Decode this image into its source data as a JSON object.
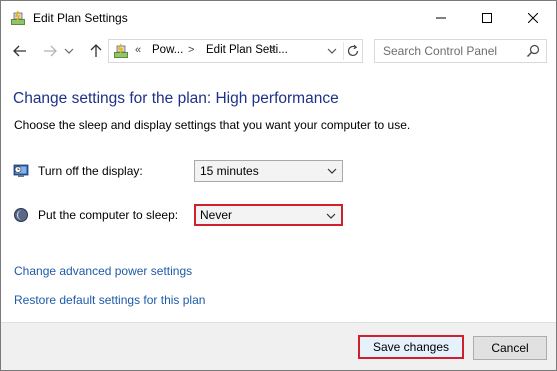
{
  "window": {
    "title": "Edit Plan Settings",
    "icon": "power-options-icon"
  },
  "navigation": {
    "back_icon": "back-arrow-icon",
    "forward_icon": "forward-arrow-icon",
    "recent_icon": "chevron-down-icon",
    "up_icon": "up-arrow-icon",
    "address": {
      "chevron": "«",
      "segments": [
        "Pow...",
        "Edit Plan Setti..."
      ],
      "separator": ">"
    },
    "search": {
      "placeholder": "Search Control Panel"
    }
  },
  "content": {
    "heading": "Change settings for the plan: High performance",
    "subtext": "Choose the sleep and display settings that you want your computer to use.",
    "settings": [
      {
        "label": "Turn off the display:",
        "value": "15 minutes",
        "icon": "monitor-clock-icon"
      },
      {
        "label": "Put the computer to sleep:",
        "value": "Never",
        "icon": "moon-icon",
        "highlighted": true
      }
    ],
    "links": [
      "Change advanced power settings",
      "Restore default settings for this plan"
    ]
  },
  "footer": {
    "save_label": "Save changes",
    "cancel_label": "Cancel"
  },
  "colors": {
    "heading": "#1e3287",
    "link": "#1e5aa8",
    "highlight": "#d0202b",
    "footer_bg": "#f0f0f0"
  }
}
